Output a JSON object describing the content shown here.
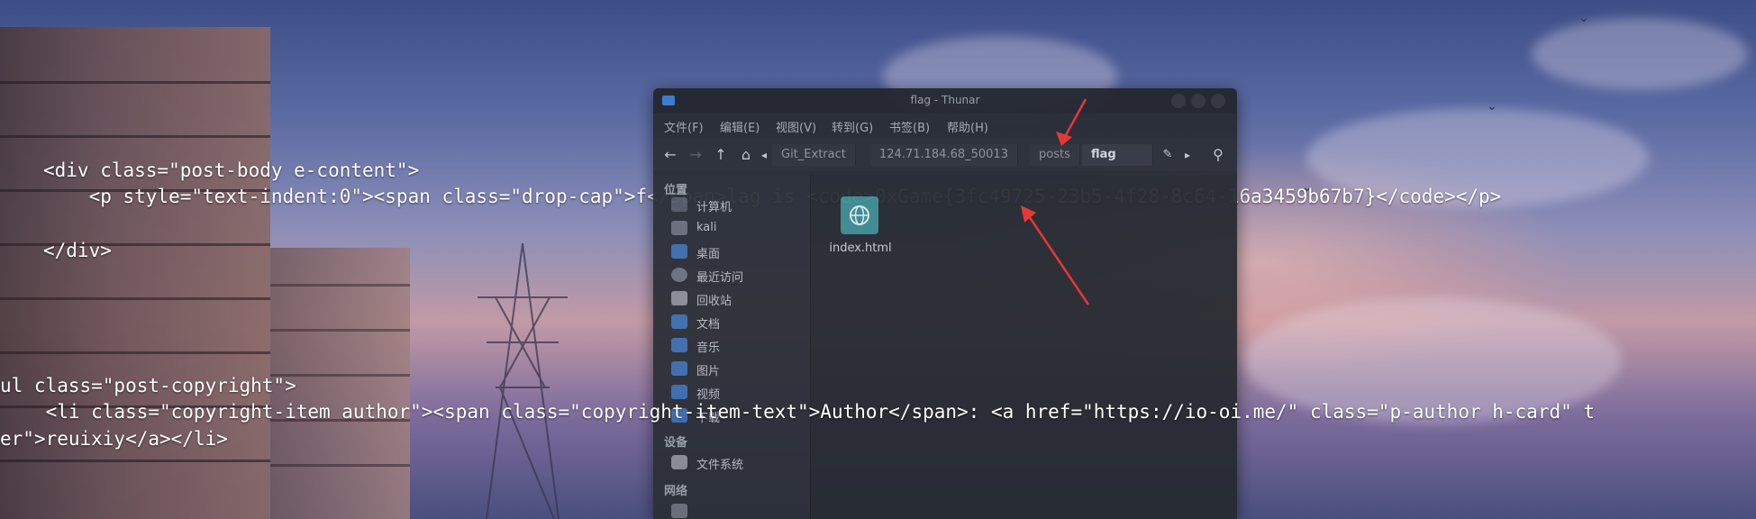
{
  "code_lines": [
    "<div class=\"post-body e-content\">",
    "    <p style=\"text-indent:0\"><span class=\"drop-cap\">f</span>lag is <code>0xGame{3fc49725-23b5-4f28-8c64-16a3459b67b7}</code></p>",
    "</div>",
    "ul class=\"post-copyright\">",
    "    <li class=\"copyright-item author\"><span class=\"copyright-item-text\">Author</span>: <a href=\"https://io-oi.me/\" class=\"p-author h-card\" t",
    "er\">reuixiy</a></li>"
  ],
  "window": {
    "title": "flag - Thunar",
    "menu": [
      "文件(F)",
      "编辑(E)",
      "视图(V)",
      "转到(G)",
      "书签(B)",
      "帮助(H)"
    ],
    "breadcrumbs": [
      "Git_Extract",
      "124.71.184.68_50013",
      "posts",
      "flag"
    ],
    "active_breadcrumb": "flag",
    "sidebar": {
      "places_header": "位置",
      "places": [
        {
          "label": "计算机",
          "icon": "computer-icon"
        },
        {
          "label": "kali",
          "icon": "home-folder-icon"
        },
        {
          "label": "桌面",
          "icon": "desktop-icon"
        },
        {
          "label": "最近访问",
          "icon": "recent-icon"
        },
        {
          "label": "回收站",
          "icon": "trash-icon"
        },
        {
          "label": "文档",
          "icon": "documents-folder-icon"
        },
        {
          "label": "音乐",
          "icon": "music-folder-icon"
        },
        {
          "label": "图片",
          "icon": "pictures-folder-icon"
        },
        {
          "label": "视频",
          "icon": "videos-folder-icon"
        },
        {
          "label": "下载",
          "icon": "downloads-folder-icon"
        }
      ],
      "devices_header": "设备",
      "devices": [
        {
          "label": "文件系统",
          "icon": "drive-icon"
        }
      ],
      "network_header": "网络"
    },
    "files": [
      {
        "name": "index.html",
        "icon": "html-file-icon"
      }
    ]
  },
  "colors": {
    "accent": "#3b7fd1",
    "arrow": "#e53935",
    "window_bg": "#282c34"
  }
}
